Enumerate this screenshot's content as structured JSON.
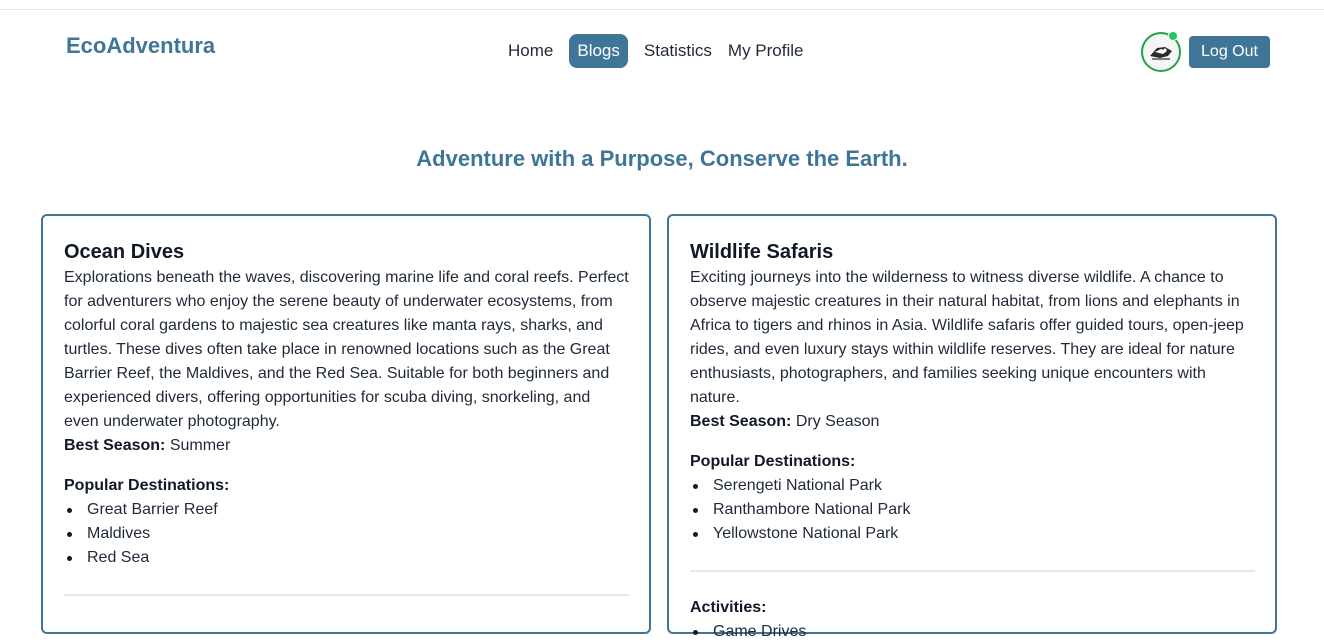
{
  "header": {
    "brand": "EcoAdventura",
    "nav": [
      "Home",
      "Blogs",
      "Statistics",
      "My Profile"
    ],
    "active_nav": "Blogs",
    "logout_label": "Log Out",
    "accent_color": "#3f7697",
    "status_color": "#22c55e"
  },
  "hero": {
    "tagline": "Adventure with a Purpose, Conserve the Earth."
  },
  "cards": [
    {
      "title": "Ocean Dives",
      "description": "Explorations beneath the waves, discovering marine life and coral reefs. Perfect for adventurers who enjoy the serene beauty of underwater ecosystems, from colorful coral gardens to majestic sea creatures like manta rays, sharks, and turtles. These dives often take place in renowned locations such as the Great Barrier Reef, the Maldives, and the Red Sea. Suitable for both beginners and experienced divers, offering opportunities for scuba diving, snorkeling, and even underwater photography.",
      "season_label": "Best Season:",
      "season": "Summer",
      "destinations_label": "Popular Destinations:",
      "destinations": [
        "Great Barrier Reef",
        "Maldives",
        "Red Sea"
      ]
    },
    {
      "title": "Wildlife Safaris",
      "description": "Exciting journeys into the wilderness to witness diverse wildlife. A chance to observe majestic creatures in their natural habitat, from lions and elephants in Africa to tigers and rhinos in Asia. Wildlife safaris offer guided tours, open-jeep rides, and even luxury stays within wildlife reserves. They are ideal for nature enthusiasts, photographers, and families seeking unique encounters with nature.",
      "season_label": "Best Season:",
      "season": "Dry Season",
      "destinations_label": "Popular Destinations:",
      "destinations": [
        "Serengeti National Park",
        "Ranthambore National Park",
        "Yellowstone National Park"
      ],
      "activities_label": "Activities:",
      "activities": [
        "Game Drives"
      ]
    }
  ]
}
